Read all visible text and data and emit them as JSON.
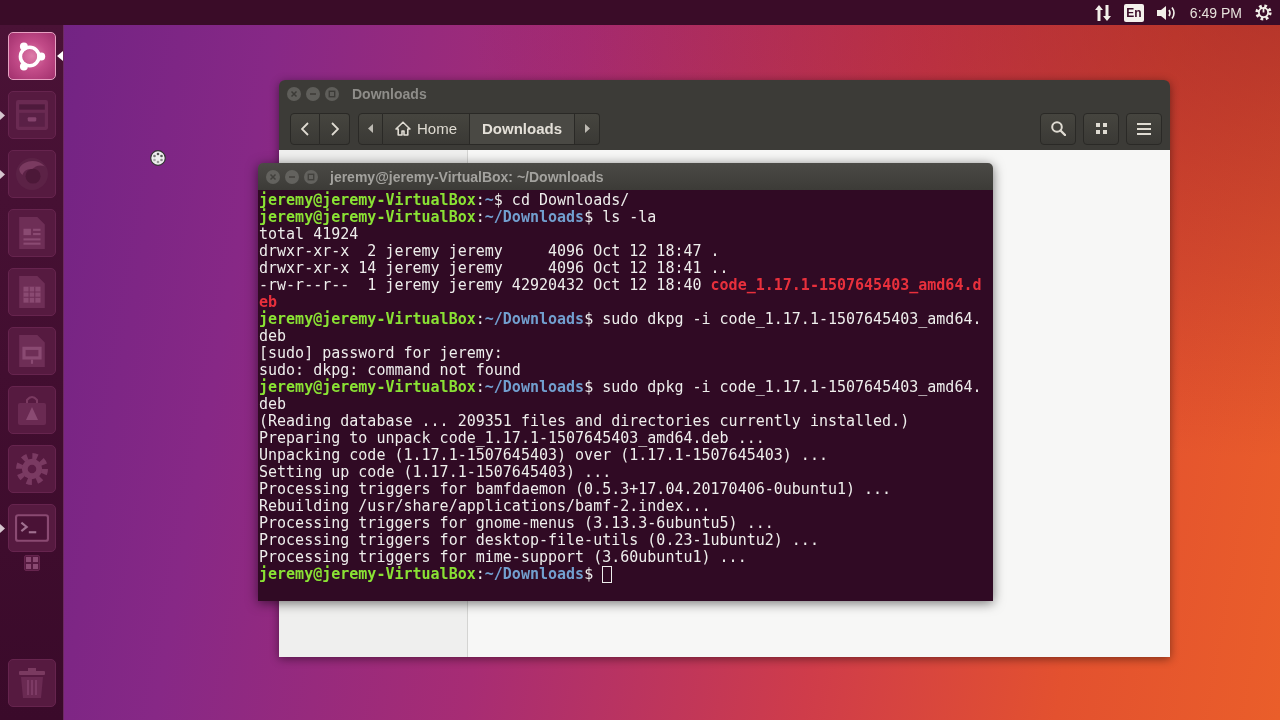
{
  "top_bar": {
    "keyboard_layout": "En",
    "clock": "6:49 PM"
  },
  "launcher": {
    "items": [
      {
        "kind": "dash",
        "selected": true,
        "running": false
      },
      {
        "kind": "files",
        "selected": false,
        "running": true
      },
      {
        "kind": "browser",
        "selected": false,
        "running": true
      },
      {
        "kind": "writer",
        "selected": false,
        "running": false
      },
      {
        "kind": "calc",
        "selected": false,
        "running": false
      },
      {
        "kind": "impress",
        "selected": false,
        "running": false
      },
      {
        "kind": "software",
        "selected": false,
        "running": false
      },
      {
        "kind": "settings",
        "selected": false,
        "running": false
      },
      {
        "kind": "terminal",
        "selected": false,
        "running": true
      },
      {
        "kind": "workspace_switcher",
        "selected": false,
        "running": false
      },
      {
        "kind": "trash",
        "selected": false,
        "running": false
      }
    ]
  },
  "file_manager": {
    "title": "Downloads",
    "path_bar": [
      {
        "kind": "home",
        "label": "Home",
        "selected": false
      },
      {
        "kind": "folder",
        "label": "Downloads",
        "selected": true
      }
    ]
  },
  "terminal": {
    "title": "jeremy@jeremy-VirtualBox: ~/Downloads",
    "cursor": true,
    "lines": [
      {
        "parts": [
          {
            "kind": "user",
            "text": "jeremy@jeremy-VirtualBox"
          },
          {
            "kind": "plain",
            "text": ":"
          },
          {
            "kind": "path",
            "text": "~"
          },
          {
            "kind": "plain",
            "text": "$ cd Downloads/"
          }
        ]
      },
      {
        "parts": [
          {
            "kind": "user",
            "text": "jeremy@jeremy-VirtualBox"
          },
          {
            "kind": "plain",
            "text": ":"
          },
          {
            "kind": "path",
            "text": "~/Downloads"
          },
          {
            "kind": "plain",
            "text": "$ ls -la"
          }
        ]
      },
      {
        "parts": [
          {
            "kind": "plain",
            "text": "total 41924"
          }
        ]
      },
      {
        "parts": [
          {
            "kind": "plain",
            "text": "drwxr-xr-x  2 jeremy jeremy     4096 Oct 12 18:47 ."
          }
        ]
      },
      {
        "parts": [
          {
            "kind": "plain",
            "text": "drwxr-xr-x 14 jeremy jeremy     4096 Oct 12 18:41 .."
          }
        ]
      },
      {
        "parts": [
          {
            "kind": "plain",
            "text": "-rw-r--r--  1 jeremy jeremy 42920432 Oct 12 18:40 "
          },
          {
            "kind": "file",
            "text": "code_1.17.1-1507645403_amd64.d"
          }
        ]
      },
      {
        "parts": [
          {
            "kind": "file",
            "text": "eb"
          }
        ]
      },
      {
        "parts": [
          {
            "kind": "user",
            "text": "jeremy@jeremy-VirtualBox"
          },
          {
            "kind": "plain",
            "text": ":"
          },
          {
            "kind": "path",
            "text": "~/Downloads"
          },
          {
            "kind": "plain",
            "text": "$ sudo dkpg -i code_1.17.1-1507645403_amd64."
          }
        ]
      },
      {
        "parts": [
          {
            "kind": "plain",
            "text": "deb"
          }
        ]
      },
      {
        "parts": [
          {
            "kind": "plain",
            "text": "[sudo] password for jeremy:"
          }
        ]
      },
      {
        "parts": [
          {
            "kind": "plain",
            "text": "sudo: dkpg: command not found"
          }
        ]
      },
      {
        "parts": [
          {
            "kind": "user",
            "text": "jeremy@jeremy-VirtualBox"
          },
          {
            "kind": "plain",
            "text": ":"
          },
          {
            "kind": "path",
            "text": "~/Downloads"
          },
          {
            "kind": "plain",
            "text": "$ sudo dpkg -i code_1.17.1-1507645403_amd64."
          }
        ]
      },
      {
        "parts": [
          {
            "kind": "plain",
            "text": "deb"
          }
        ]
      },
      {
        "parts": [
          {
            "kind": "plain",
            "text": "(Reading database ... 209351 files and directories currently installed.)"
          }
        ]
      },
      {
        "parts": [
          {
            "kind": "plain",
            "text": "Preparing to unpack code_1.17.1-1507645403_amd64.deb ..."
          }
        ]
      },
      {
        "parts": [
          {
            "kind": "plain",
            "text": "Unpacking code (1.17.1-1507645403) over (1.17.1-1507645403) ..."
          }
        ]
      },
      {
        "parts": [
          {
            "kind": "plain",
            "text": "Setting up code (1.17.1-1507645403) ..."
          }
        ]
      },
      {
        "parts": [
          {
            "kind": "plain",
            "text": "Processing triggers for bamfdaemon (0.5.3+17.04.20170406-0ubuntu1) ..."
          }
        ]
      },
      {
        "parts": [
          {
            "kind": "plain",
            "text": "Rebuilding /usr/share/applications/bamf-2.index..."
          }
        ]
      },
      {
        "parts": [
          {
            "kind": "plain",
            "text": "Processing triggers for gnome-menus (3.13.3-6ubuntu5) ..."
          }
        ]
      },
      {
        "parts": [
          {
            "kind": "plain",
            "text": "Processing triggers for desktop-file-utils (0.23-1ubuntu2) ..."
          }
        ]
      },
      {
        "parts": [
          {
            "kind": "plain",
            "text": "Processing triggers for mime-support (3.60ubuntu1) ..."
          }
        ]
      },
      {
        "parts": [
          {
            "kind": "user",
            "text": "jeremy@jeremy-VirtualBox"
          },
          {
            "kind": "plain",
            "text": ":"
          },
          {
            "kind": "path",
            "text": "~/Downloads"
          },
          {
            "kind": "plain",
            "text": "$ "
          }
        ]
      }
    ]
  }
}
